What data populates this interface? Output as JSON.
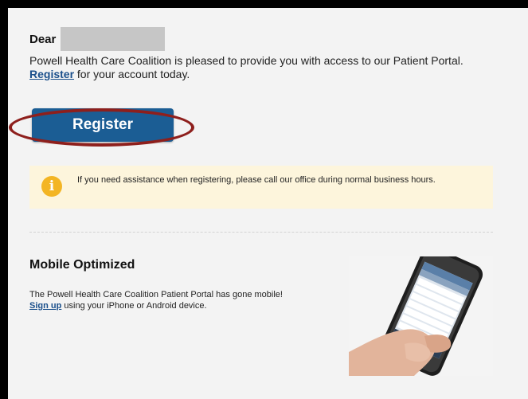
{
  "greeting": {
    "dear": "Dear"
  },
  "intro": {
    "text_before": "Powell Health Care Coalition is pleased to provide you with access to our Patient Portal. ",
    "link": "Register",
    "text_after": " for your account today."
  },
  "register_button": {
    "label": "Register"
  },
  "notice": {
    "icon": "info-icon",
    "icon_glyph": "i",
    "text": "If you need assistance when registering, please call our office during normal business hours."
  },
  "mobile": {
    "title": "Mobile Optimized",
    "text": "The Powell Health Care Coalition Patient Portal has gone mobile!",
    "link": "Sign up",
    "text_after": " using your iPhone or Android device.",
    "image": "smartphone-in-hand-image"
  },
  "colors": {
    "button": "#1b5d94",
    "link": "#1a4f8b",
    "highlight_ellipse": "#8e1f1c",
    "notice_bg": "#fdf5dc",
    "info_icon": "#f3b524",
    "page_bg": "#f3f3f3",
    "border": "#000000"
  }
}
